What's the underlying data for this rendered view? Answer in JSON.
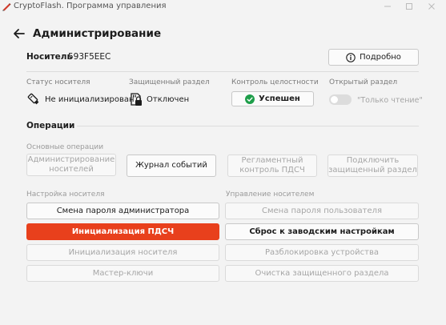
{
  "window": {
    "title": "CryptoFlash. Программа управления"
  },
  "header": {
    "title": "Администрирование"
  },
  "carrier": {
    "label": "Носитель",
    "id": "593F5EEC",
    "details_label": "Подробно"
  },
  "status": {
    "carrier_status": {
      "label": "Статус носителя",
      "value": "Не инициализирован"
    },
    "protected_partition": {
      "label": "Защищенный раздел",
      "value": "Отключен"
    },
    "integrity": {
      "label": "Контроль целостности",
      "value": "Успешен"
    },
    "open_partition": {
      "label": "Открытый раздел",
      "value": "\"Только чтение\""
    }
  },
  "operations": {
    "title": "Операции",
    "basic": {
      "label": "Основные операции",
      "admin_carriers": "Администрирование носителей",
      "event_log": "Журнал событий",
      "regulation_control": "Регламентный контроль ПДСЧ",
      "connect_protected": "Подключить защищенный раздел"
    },
    "carrier_setup": {
      "label": "Настройка носителя",
      "change_admin_password": "Смена пароля администратора",
      "init_pdsch": "Инициализация ПДСЧ",
      "init_carrier": "Инициализация носителя",
      "master_keys": "Мастер-ключи"
    },
    "carrier_management": {
      "label": "Управление носителем",
      "change_user_password": "Смена пароля пользователя",
      "factory_reset": "Сброс к заводским настройкам",
      "unlock_device": "Разблокировка устройства",
      "clear_protected": "Очистка защищенного раздела"
    }
  },
  "colors": {
    "accent": "#e8401c",
    "success": "#1e9e4a",
    "disabled_text": "#a6a6a6"
  }
}
